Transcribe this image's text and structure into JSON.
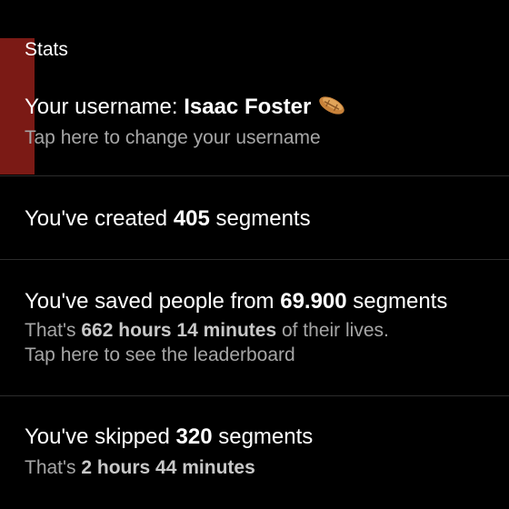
{
  "section": {
    "title": "Stats"
  },
  "username": {
    "prefix": "Your username: ",
    "name": "Isaac Foster",
    "subtitle": "Tap here to change your username",
    "badge_icon": "trophy-icon"
  },
  "created": {
    "prefix": "You've created ",
    "count": "405",
    "suffix": " segments"
  },
  "saved": {
    "prefix": "You've saved people from ",
    "count": "69.900",
    "suffix": " segments",
    "line1_prefix": "That's ",
    "line1_time": "662 hours 14 minutes",
    "line1_suffix": " of their lives.",
    "line2": "Tap here to see the leaderboard"
  },
  "skipped": {
    "prefix": "You've skipped ",
    "count": "320",
    "suffix": " segments",
    "sub_prefix": "That's ",
    "sub_time": "2 hours 44 minutes"
  },
  "colors": {
    "background": "#000000",
    "focus_highlight": "#7b1a15",
    "primary_text": "#ffffff",
    "secondary_text": "#a6a6a6",
    "divider": "#2c2c2c",
    "trophy": "#c8823a"
  }
}
